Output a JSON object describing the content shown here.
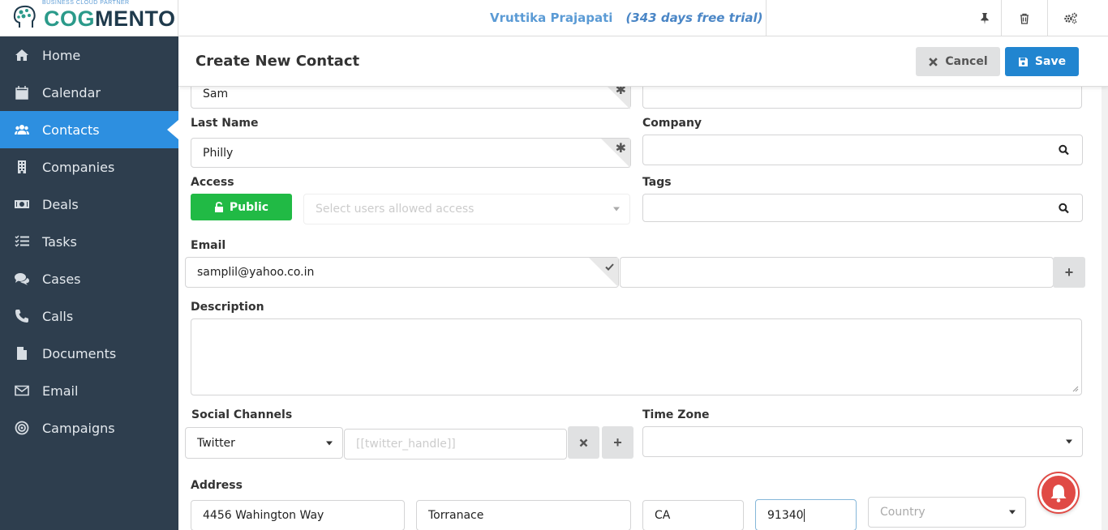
{
  "app": {
    "logo_part1": "COG",
    "logo_part2": "MENTO",
    "logo_tagline": "BUSINESS CLOUD PARTNER",
    "user_name": "Vruttika Prajapati",
    "trial_text": "(343 days free trial)"
  },
  "sidebar": {
    "items": [
      {
        "label": "Home",
        "icon": "home-icon"
      },
      {
        "label": "Calendar",
        "icon": "calendar-icon"
      },
      {
        "label": "Contacts",
        "icon": "users-icon",
        "active": true
      },
      {
        "label": "Companies",
        "icon": "building-icon"
      },
      {
        "label": "Deals",
        "icon": "money-icon"
      },
      {
        "label": "Tasks",
        "icon": "tasks-icon"
      },
      {
        "label": "Cases",
        "icon": "comments-icon"
      },
      {
        "label": "Calls",
        "icon": "phone-icon"
      },
      {
        "label": "Documents",
        "icon": "file-icon"
      },
      {
        "label": "Email",
        "icon": "envelope-icon"
      },
      {
        "label": "Campaigns",
        "icon": "bullseye-icon"
      }
    ]
  },
  "header": {
    "title": "Create New Contact",
    "cancel_label": "Cancel",
    "save_label": "Save"
  },
  "form": {
    "first_name_value": "Sam",
    "last_name_label": "Last Name",
    "last_name_value": "Philly",
    "company_label": "Company",
    "company_value": "",
    "access_label": "Access",
    "access_button": "Public",
    "access_users_placeholder": "Select users allowed access",
    "tags_label": "Tags",
    "email_label": "Email",
    "email_value": "samplil@yahoo.co.in",
    "email_secondary_value": "",
    "description_label": "Description",
    "description_value": "",
    "social_label": "Social Channels",
    "social_channel": "Twitter",
    "social_handle_placeholder": "[[twitter_handle]]",
    "timezone_label": "Time Zone",
    "timezone_value": "",
    "address_label": "Address",
    "street_value": "4456 Wahington Way",
    "city_value": "Torranace",
    "state_value": "CA",
    "zip_value": "91340",
    "country_placeholder": "Country"
  },
  "colors": {
    "sidebar_bg": "#2e3e4e",
    "active_nav": "#2d8fe0",
    "save_button": "#2185d0",
    "public_button": "#21ba45",
    "notification": "#e04a45"
  }
}
